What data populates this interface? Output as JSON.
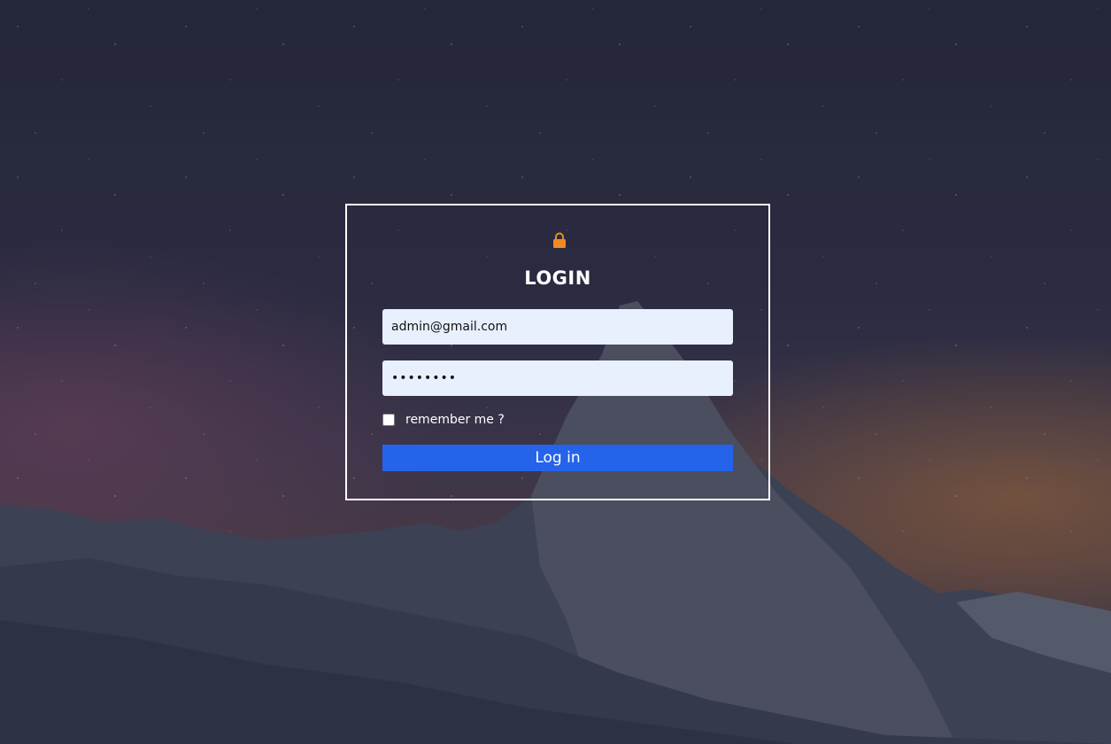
{
  "login": {
    "lock_icon": "lock-icon",
    "title": "LOGIN",
    "email_value": "admin@gmail.com",
    "password_masked": "••••••••",
    "remember_label": "remember me ?",
    "login_button": "Log in"
  },
  "colors": {
    "lock_icon": "#f08a24",
    "button": "#2563eb",
    "field_bg": "#e8f0fe",
    "border": "#ffffff"
  }
}
